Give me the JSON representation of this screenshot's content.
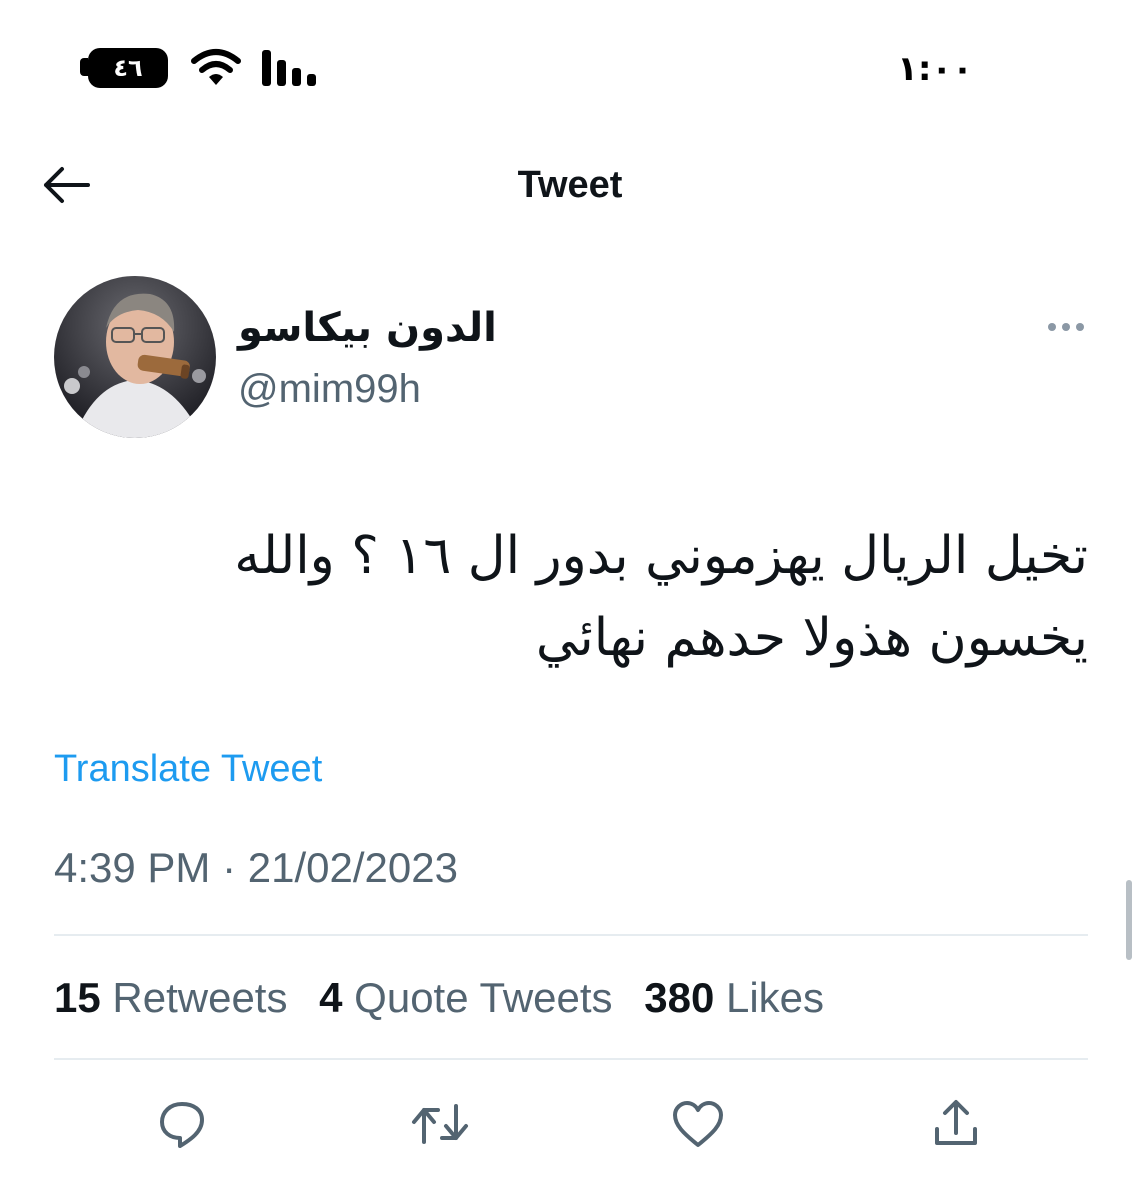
{
  "status_bar": {
    "battery": "٤٦",
    "time": "١:٠٠"
  },
  "header": {
    "title": "Tweet"
  },
  "author": {
    "name": "الدون بيكاسو",
    "handle": "@mim99h"
  },
  "tweet": {
    "text": "تخيل الريال يهزموني بدور ال ١٦ ؟ والله يخسون هذولا حدهم نهائي",
    "translate_label": "Translate Tweet",
    "timestamp": "4:39 PM · 21/02/2023"
  },
  "stats": {
    "retweets": {
      "count": "15",
      "label": "Retweets"
    },
    "quote_tweets": {
      "count": "4",
      "label": "Quote Tweets"
    },
    "likes": {
      "count": "380",
      "label": "Likes"
    }
  },
  "icons": {
    "back": "arrow-left-icon",
    "more": "more-horizontal-icon",
    "reply": "reply-icon",
    "retweet": "retweet-icon",
    "like": "heart-icon",
    "share": "share-icon",
    "wifi": "wifi-icon",
    "signal": "signal-bars-icon",
    "battery": "battery-icon"
  },
  "colors": {
    "accent": "#1d9bf0",
    "secondary_text": "#536471",
    "primary_text": "#0f1419",
    "divider": "#e6ecf0"
  }
}
